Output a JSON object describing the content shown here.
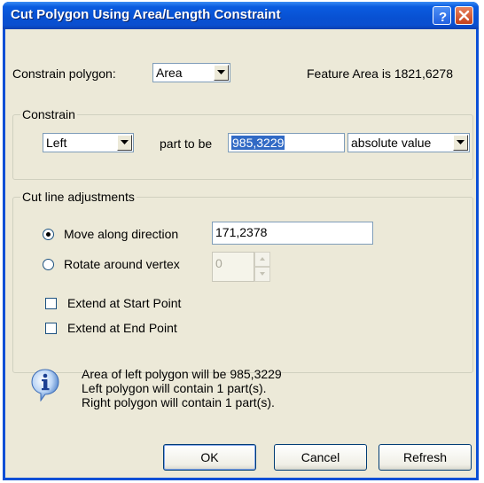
{
  "window": {
    "title": "Cut Polygon Using Area/Length Constraint"
  },
  "titlebar": {
    "help_icon": "help-icon",
    "close_icon": "close-icon"
  },
  "top": {
    "constrain_label": "Constrain polygon:",
    "constrain_value": "Area",
    "feature_area": "Feature Area is 1821,6278"
  },
  "constrain_group": {
    "legend": "Constrain",
    "side_value": "Left",
    "part_to_be_label": "part to be",
    "amount_value": "985,3229",
    "mode_value": "absolute value"
  },
  "cutline_group": {
    "legend": "Cut line adjustments",
    "move_label": "Move along direction",
    "move_value": "171,2378",
    "rotate_label": "Rotate around vertex",
    "rotate_value": "0",
    "extend_start_label": "Extend at Start Point",
    "extend_end_label": "Extend at End Point",
    "move_selected": true,
    "rotate_selected": false,
    "extend_start_checked": false,
    "extend_end_checked": false
  },
  "info": {
    "icon": "info-icon",
    "line1": "Area of left polygon will be 985,3229",
    "line2": "Left polygon will contain 1 part(s).",
    "line3": "Right polygon will contain 1 part(s)."
  },
  "buttons": {
    "ok": "OK",
    "cancel": "Cancel",
    "refresh": "Refresh"
  }
}
